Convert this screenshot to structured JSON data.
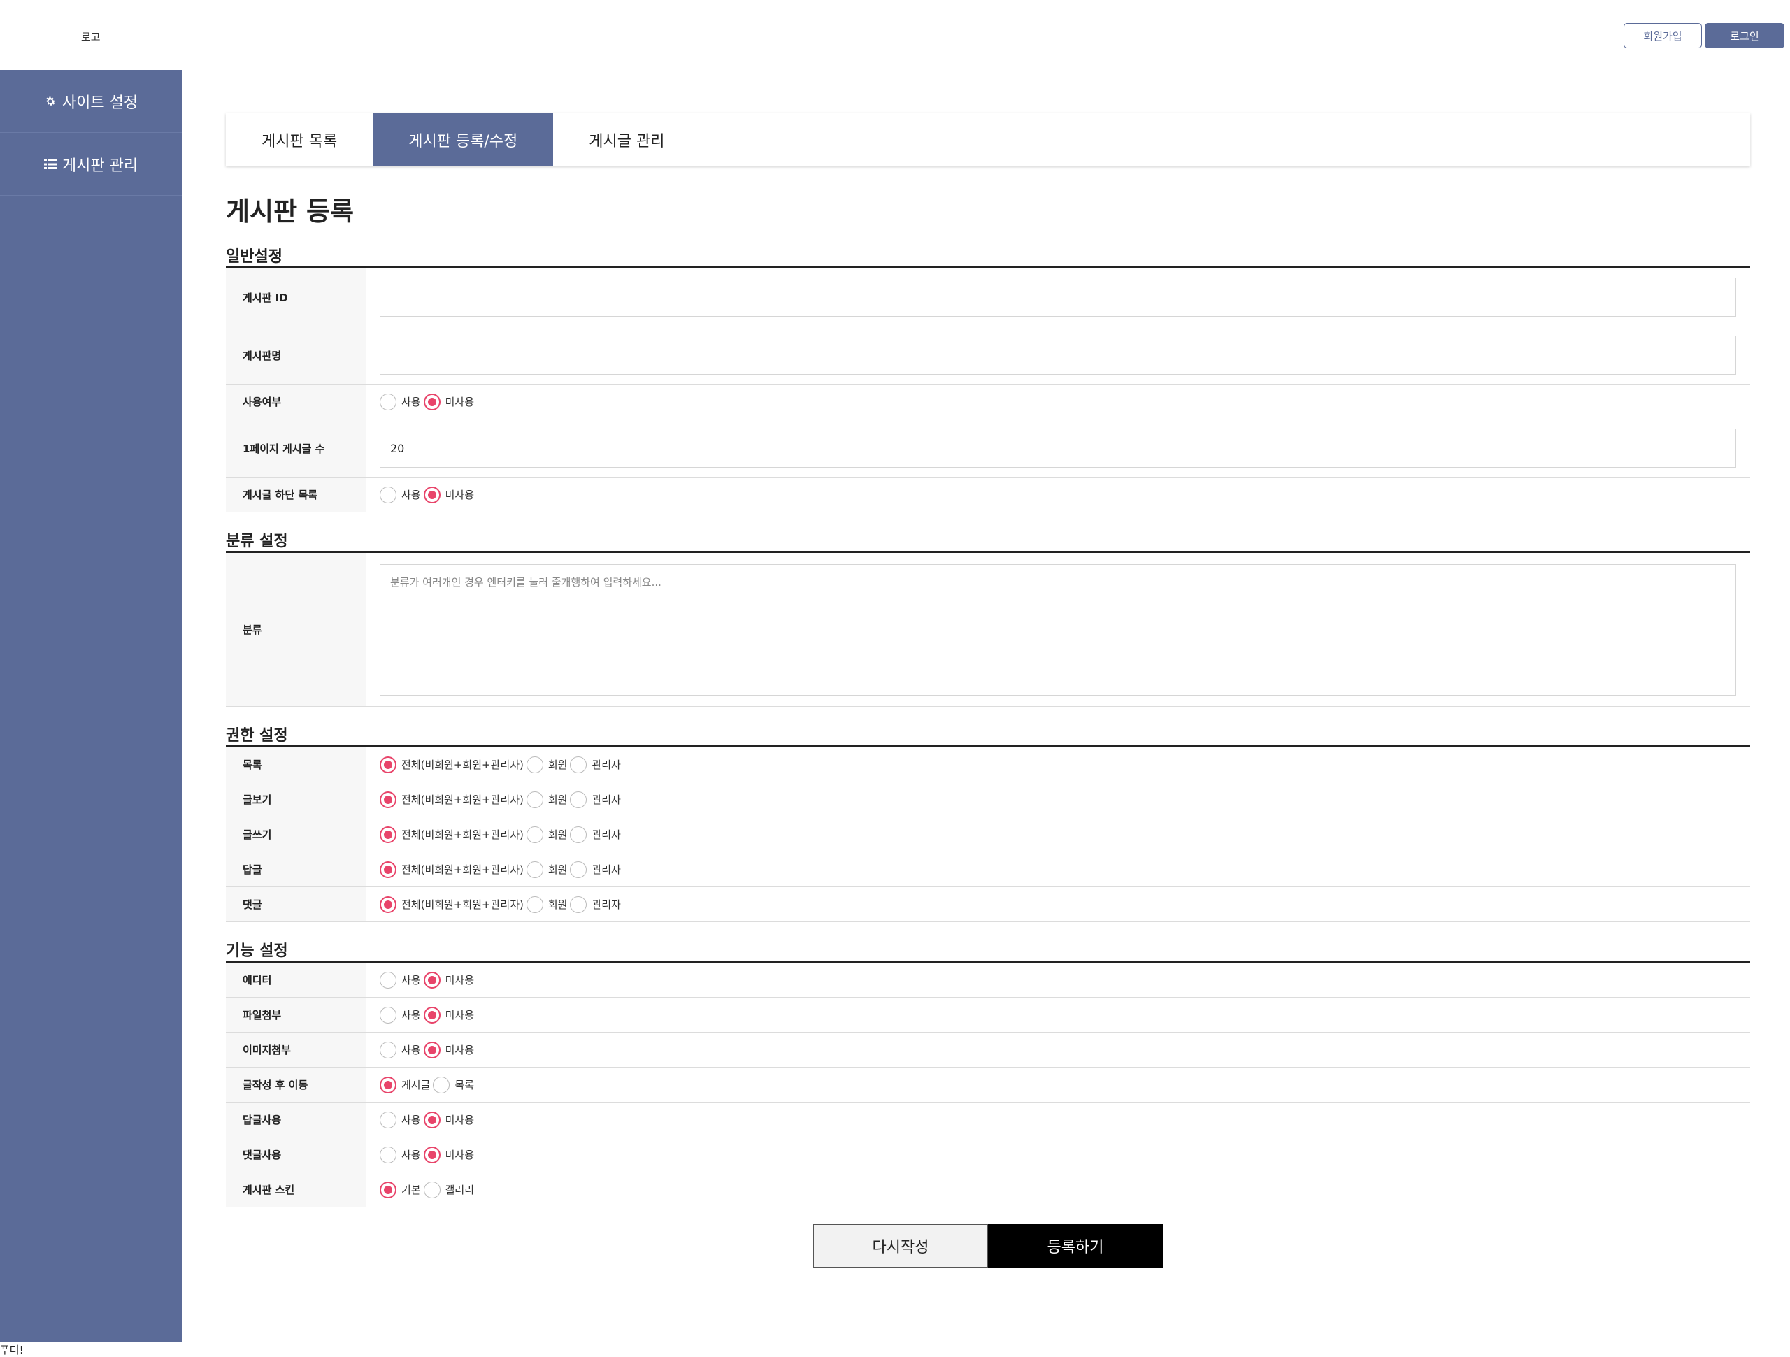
{
  "header": {
    "logo": "로고",
    "join_label": "회원가입",
    "login_label": "로그인"
  },
  "sidebar": {
    "items": [
      {
        "label": "사이트 설정",
        "icon": "gear-icon"
      },
      {
        "label": "게시판 관리",
        "icon": "list-icon"
      }
    ]
  },
  "tabs": [
    {
      "label": "게시판 목록"
    },
    {
      "label": "게시판 등록/수정",
      "active": true
    },
    {
      "label": "게시글 관리"
    }
  ],
  "page_title": "게시판 등록",
  "general": {
    "title": "일반설정",
    "board_id": {
      "label": "게시판 ID",
      "value": ""
    },
    "board_name": {
      "label": "게시판명",
      "value": ""
    },
    "use": {
      "label": "사용여부",
      "opt1": "사용",
      "opt2": "미사용"
    },
    "per_page": {
      "label": "1페이지 게시글 수",
      "value": "20"
    },
    "bottom_list": {
      "label": "게시글 하단 목록",
      "opt1": "사용",
      "opt2": "미사용"
    }
  },
  "category": {
    "title": "분류 설정",
    "label": "분류",
    "placeholder": "분류가 여러개인 경우 엔터키를 눌러 줄개행하여 입력하세요..."
  },
  "permission": {
    "title": "권한 설정",
    "opt_all": "전체(비회원+회원+관리자)",
    "opt_member": "회원",
    "opt_admin": "관리자",
    "rows": [
      {
        "label": "목록"
      },
      {
        "label": "글보기"
      },
      {
        "label": "글쓰기"
      },
      {
        "label": "답글"
      },
      {
        "label": "댓글"
      }
    ]
  },
  "feature": {
    "title": "기능 설정",
    "use": "사용",
    "nouse": "미사용",
    "editor": "에디터",
    "file": "파일첨부",
    "image": "이미지첨부",
    "after_write": {
      "label": "글작성 후 이동",
      "opt1": "게시글",
      "opt2": "목록"
    },
    "reply": "답글사용",
    "comment": "댓글사용",
    "skin": {
      "label": "게시판 스킨",
      "opt1": "기본",
      "opt2": "갤러리"
    }
  },
  "buttons": {
    "reset": "다시작성",
    "submit": "등록하기"
  },
  "footer": "푸터!",
  "colors": {
    "primary": "#5b6b98",
    "radio_accent": "#e8446a"
  }
}
